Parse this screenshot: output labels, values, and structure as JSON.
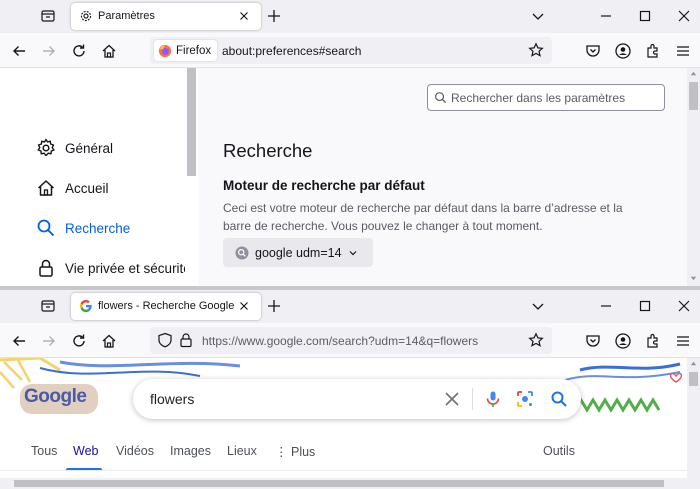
{
  "window_top": {
    "tab_title": "Paramètres",
    "identity_label": "Firefox",
    "url": "about:preferences#search",
    "search_placeholder": "Rechercher dans les paramètres",
    "sidebar": {
      "items": [
        {
          "label": "Général",
          "icon": "gear-icon"
        },
        {
          "label": "Accueil",
          "icon": "home-icon"
        },
        {
          "label": "Recherche",
          "icon": "search-icon"
        },
        {
          "label": "Vie privée et sécurité",
          "icon": "lock-icon"
        }
      ]
    },
    "heading": "Recherche",
    "section_title": "Moteur de recherche par défaut",
    "description": "Ceci est votre moteur de recherche par défaut dans la barre d’adresse et la barre de recherche. Vous pouvez le changer à tout moment.",
    "engine_selected": "google udm=14"
  },
  "window_bottom": {
    "tab_title": "flowers - Recherche Google",
    "url": "https://www.google.com/search?udm=14&q=flowers",
    "logo_text": "Google",
    "query": "flowers",
    "tabs": [
      "Tous",
      "Web",
      "Vidéos",
      "Images",
      "Lieux",
      "Plus"
    ],
    "active_tab": "Web",
    "tools_label": "Outils"
  },
  "colors": {
    "accent": "#0061e0",
    "google_blue": "#1a73e8",
    "chrome_bg": "#f0f0f4"
  }
}
